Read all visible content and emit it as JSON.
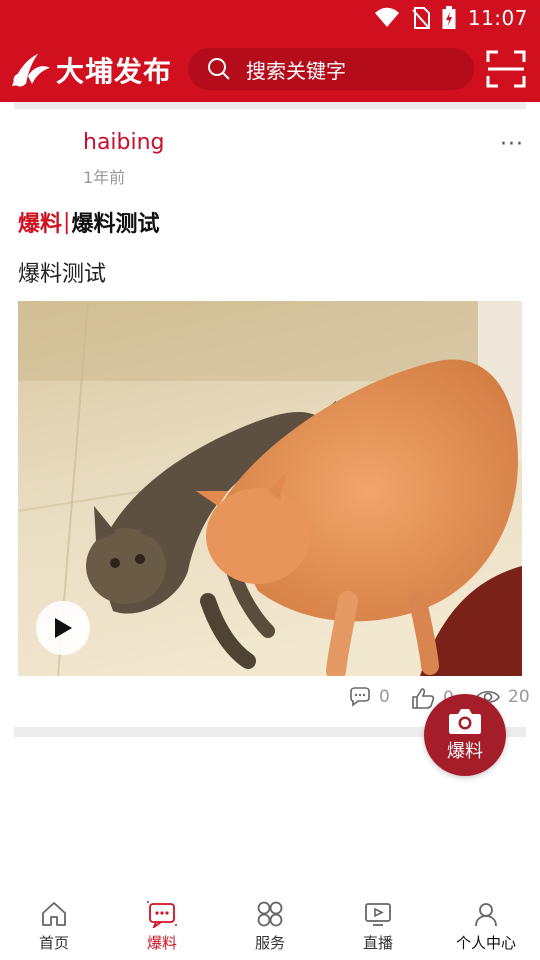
{
  "status_bar": {
    "time": "11:07"
  },
  "header": {
    "app_name": "大埔发布",
    "search_placeholder": "搜索关键字"
  },
  "post": {
    "author": "haibing",
    "time": "1年前",
    "more": "···",
    "tag": "爆料",
    "separator": "|",
    "title": "爆料测试",
    "content": "爆料测试",
    "stats": {
      "comments": "0",
      "likes": "0",
      "views": "20"
    }
  },
  "fab": {
    "label": "爆料"
  },
  "bottom_nav": {
    "items": [
      {
        "label": "首页",
        "icon": "home-icon"
      },
      {
        "label": "爆料",
        "icon": "message-dots-icon"
      },
      {
        "label": "服务",
        "icon": "grid-circles-icon"
      },
      {
        "label": "直播",
        "icon": "tv-play-icon"
      },
      {
        "label": "个人中心",
        "icon": "user-icon"
      }
    ],
    "active_index": 1
  },
  "colors": {
    "brand": "#d0101f",
    "fab": "#a61d2a",
    "muted": "#999999"
  }
}
